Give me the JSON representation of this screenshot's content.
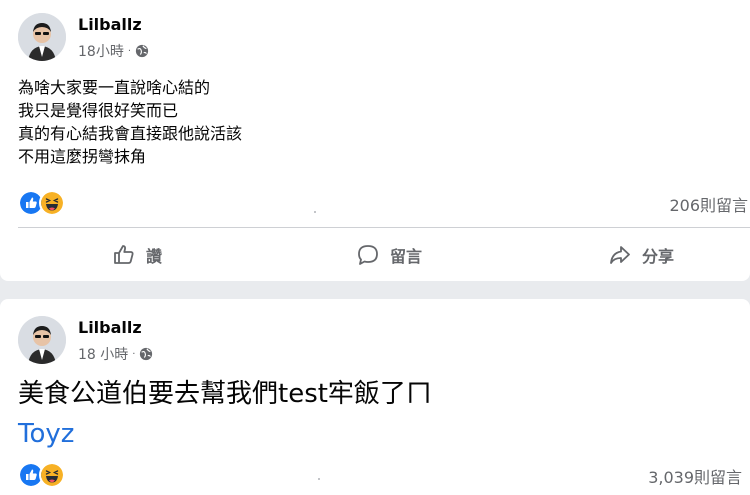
{
  "posts": [
    {
      "author": "Lilballz",
      "time": "18小時",
      "separator": "·",
      "text_lines": [
        "為啥大家要一直說啥心結的",
        "我只是覺得很好笑而已",
        "真的有心結我會直接跟他說活該",
        "不用這麼拐彎抹角"
      ],
      "reactions": [
        "like",
        "haha"
      ],
      "comments": "206則留言",
      "actions": {
        "like": "讚",
        "comment": "留言",
        "share": "分享"
      }
    },
    {
      "author": "Lilballz",
      "time": "18 小時",
      "separator": "·",
      "text": "美食公道伯要去幫我們test牢飯了ㄇ",
      "link": "Toyz",
      "reactions": [
        "like",
        "haha"
      ],
      "comments": "3,039則留言"
    }
  ],
  "colors": {
    "like_blue": "#1877f2",
    "haha_yellow": "#f7b125",
    "link_blue": "#216fdb",
    "secondary_text": "#65676b"
  },
  "icons": [
    "globe-icon",
    "like-reaction-icon",
    "haha-reaction-icon",
    "thumb-up-icon",
    "comment-bubble-icon",
    "share-arrow-icon"
  ]
}
